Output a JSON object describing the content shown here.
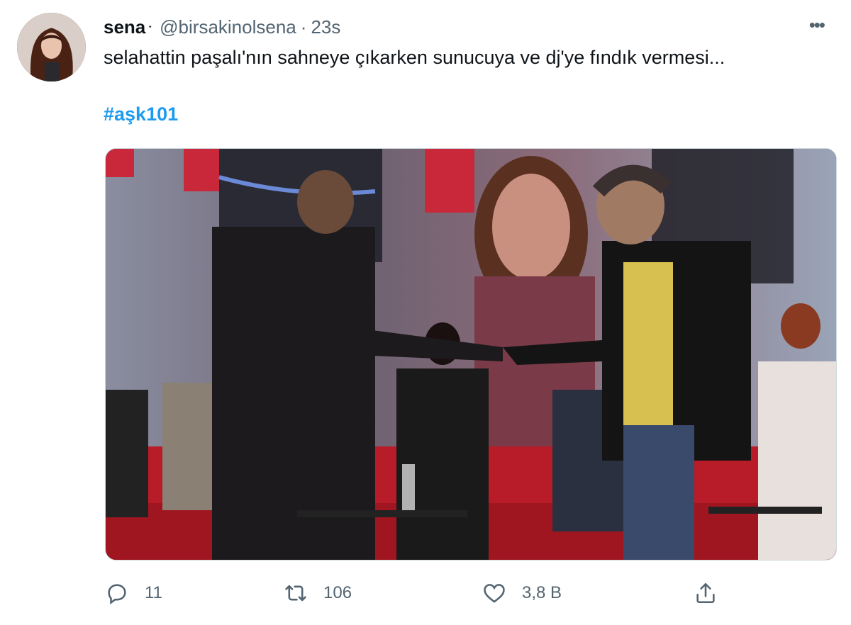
{
  "tweet": {
    "display_name": "sena",
    "verified_mark": "⋆",
    "handle": "@birsakinolsena",
    "separator": "·",
    "time": "23s",
    "text": "selahattin paşalı'nın sahneye çıkarken sunucuya ve dj'ye fındık vermesi...",
    "hashtag": "#aşk101"
  },
  "actions": {
    "reply_count": "11",
    "retweet_count": "106",
    "like_count": "3,8 B"
  },
  "icons": {
    "more": "more-icon",
    "reply": "reply-icon",
    "retweet": "retweet-icon",
    "like": "heart-icon",
    "share": "share-icon"
  },
  "colors": {
    "text": "#0f1419",
    "secondary": "#536471",
    "link": "#1d9bf0"
  }
}
